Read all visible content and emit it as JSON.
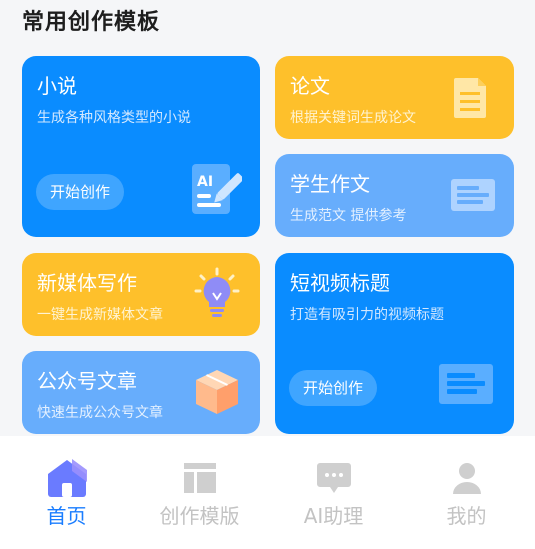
{
  "section": {
    "title": "常用创作模板"
  },
  "cards": {
    "novel": {
      "title": "小说",
      "subtitle": "生成各种风格类型的小说",
      "button": "开始创作"
    },
    "paper": {
      "title": "论文",
      "subtitle": "根据关键词生成论文"
    },
    "essay": {
      "title": "学生作文",
      "subtitle": "生成范文 提供参考"
    },
    "media": {
      "title": "新媒体写作",
      "subtitle": "一键生成新媒体文章"
    },
    "video": {
      "title": "短视频标题",
      "subtitle": "打造有吸引力的视频标题",
      "button": "开始创作"
    },
    "wechat": {
      "title": "公众号文章",
      "subtitle": "快速生成公众号文章"
    }
  },
  "icons": {
    "novel": "ai-writing-icon",
    "paper": "document-icon",
    "essay": "article-icon",
    "media": "lightbulb-icon",
    "video": "title-list-icon",
    "wechat": "box-icon"
  },
  "tabbar": {
    "items": [
      {
        "label": "首页",
        "icon": "home-icon",
        "active": true
      },
      {
        "label": "创作模版",
        "icon": "template-icon",
        "active": false
      },
      {
        "label": "AI助理",
        "icon": "chat-icon",
        "active": false
      },
      {
        "label": "我的",
        "icon": "user-icon",
        "active": false
      }
    ]
  },
  "colors": {
    "primary": "#0a8cff",
    "light_blue": "#67adfc",
    "yellow": "#fec02b",
    "tab_active": "#1a7dff",
    "tab_inactive": "#c3c3c3"
  }
}
